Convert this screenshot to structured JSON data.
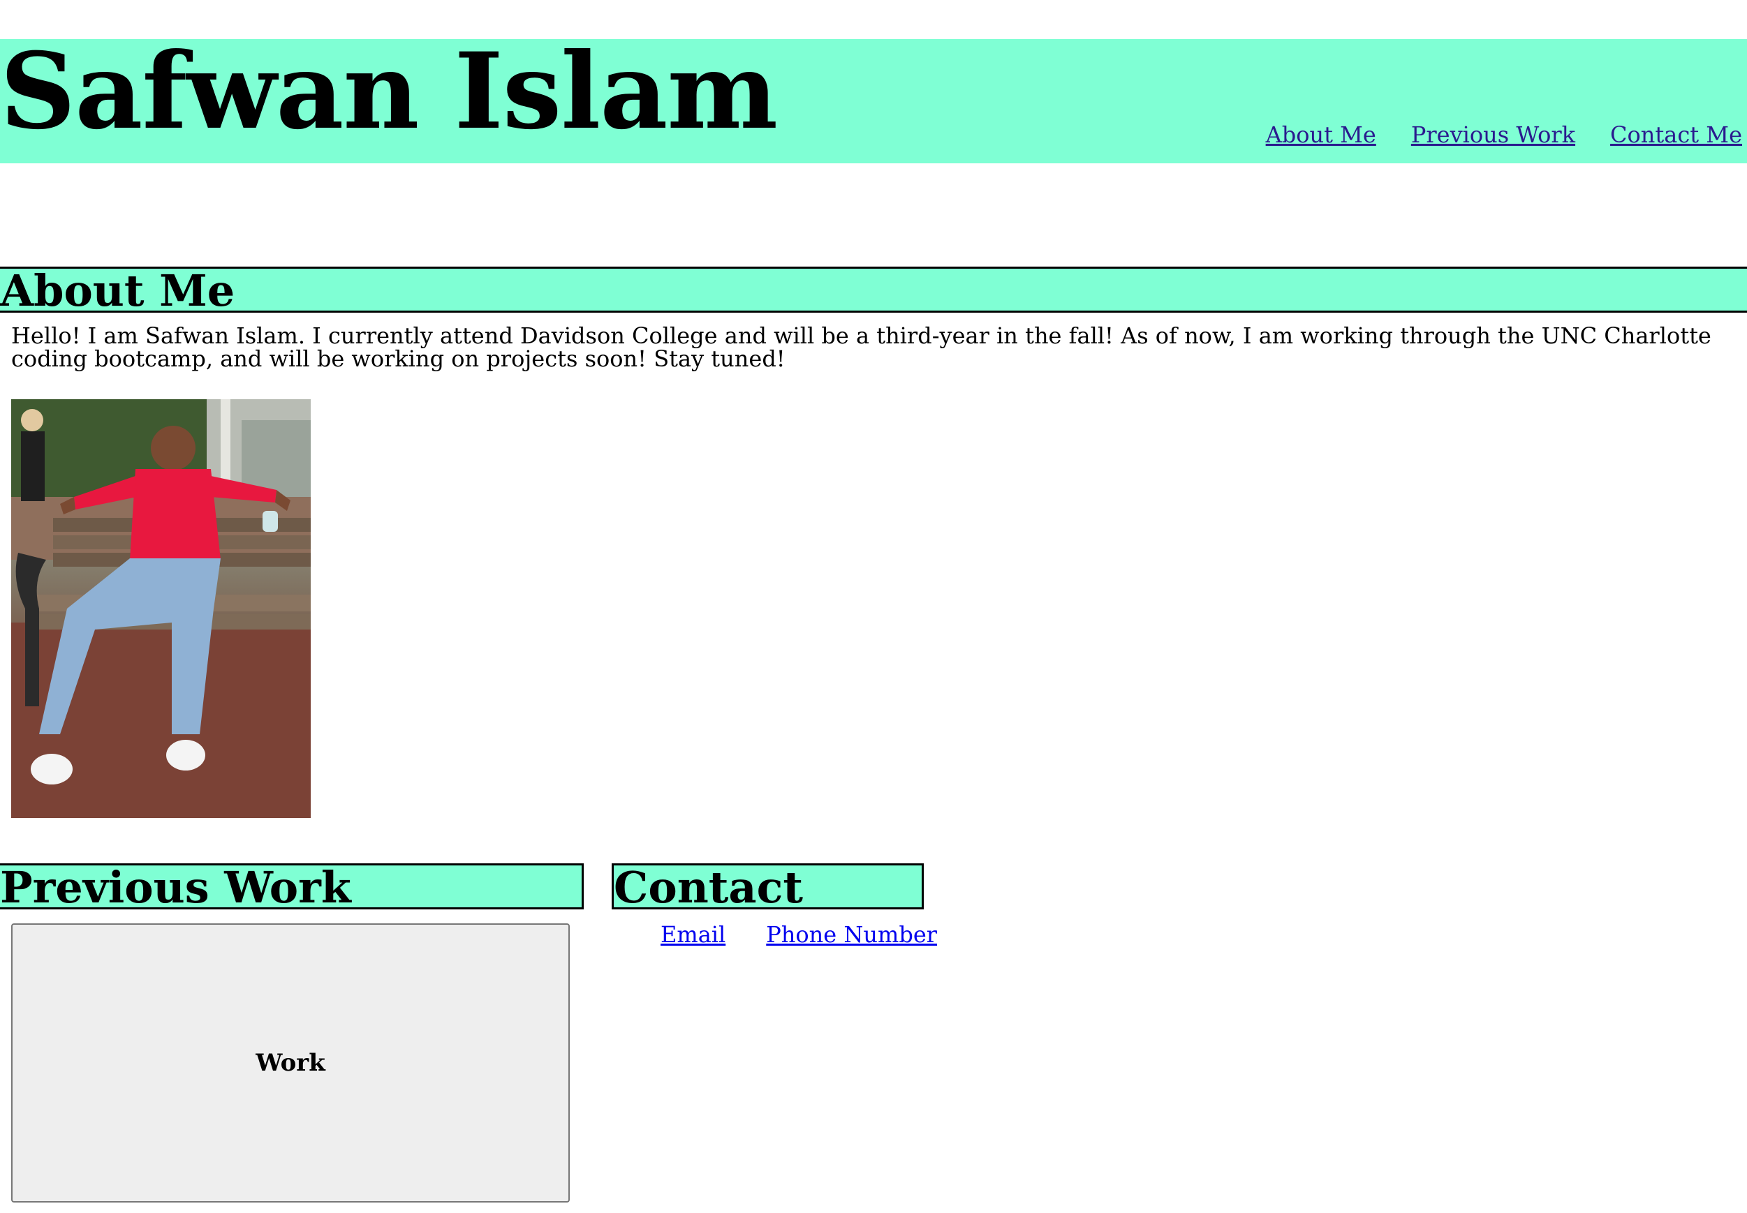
{
  "header": {
    "title": "Safwan Islam",
    "nav": [
      {
        "label": "About Me"
      },
      {
        "label": "Previous Work"
      },
      {
        "label": "Contact Me"
      }
    ]
  },
  "about": {
    "heading": "About Me",
    "text": "Hello! I am Safwan Islam. I currently attend Davidson College and will be a third-year in the fall! As of now, I am working through the UNC Charlotte coding bootcamp, and will be working on projects soon! Stay tuned!"
  },
  "work": {
    "heading": "Previous Work",
    "card_label": "Work"
  },
  "contact": {
    "heading": "Contact",
    "links": [
      {
        "label": "Email"
      },
      {
        "label": "Phone Number"
      }
    ]
  },
  "colors": {
    "accent": "#7fffd4",
    "nav_link": "#2a1a8e",
    "link": "#0000ee",
    "card_bg": "#eeeeee"
  }
}
